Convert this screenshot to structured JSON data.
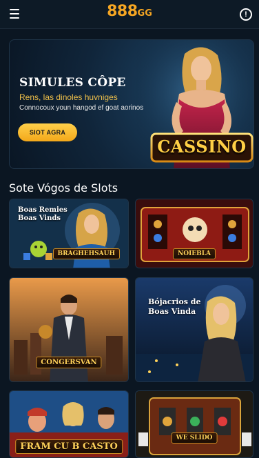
{
  "header": {
    "logo_number": "888",
    "logo_suffix": "GG",
    "info_glyph": "!"
  },
  "hero": {
    "title": "SIMULES CÔPE",
    "subtitle": "Rens, las dinoles huvniges",
    "tagline": "Connocoux youn hangod ef goat aorinos",
    "button_label": "SIOT AGRA",
    "badge": "CASSINO"
  },
  "section": {
    "title": "Sote Vógos de Slots"
  },
  "cards": [
    {
      "text": "Boas Remies\nBoas Vinds",
      "label": "BRAGHEHSAUH"
    },
    {
      "text": "",
      "label": "NOIEBLA"
    },
    {
      "text": "",
      "label": "CONGERSVAN"
    },
    {
      "text": "Bójacrios de\nBoas Vinda",
      "label": ""
    },
    {
      "text": "",
      "label": "FRAM CU B CASTO"
    },
    {
      "text": "",
      "label": "WE SLIDO"
    }
  ],
  "colors": {
    "accent": "#f5a623",
    "background": "#0b1622",
    "button": "#ffc637"
  },
  "icons": [
    "menu-icon",
    "info-icon"
  ]
}
